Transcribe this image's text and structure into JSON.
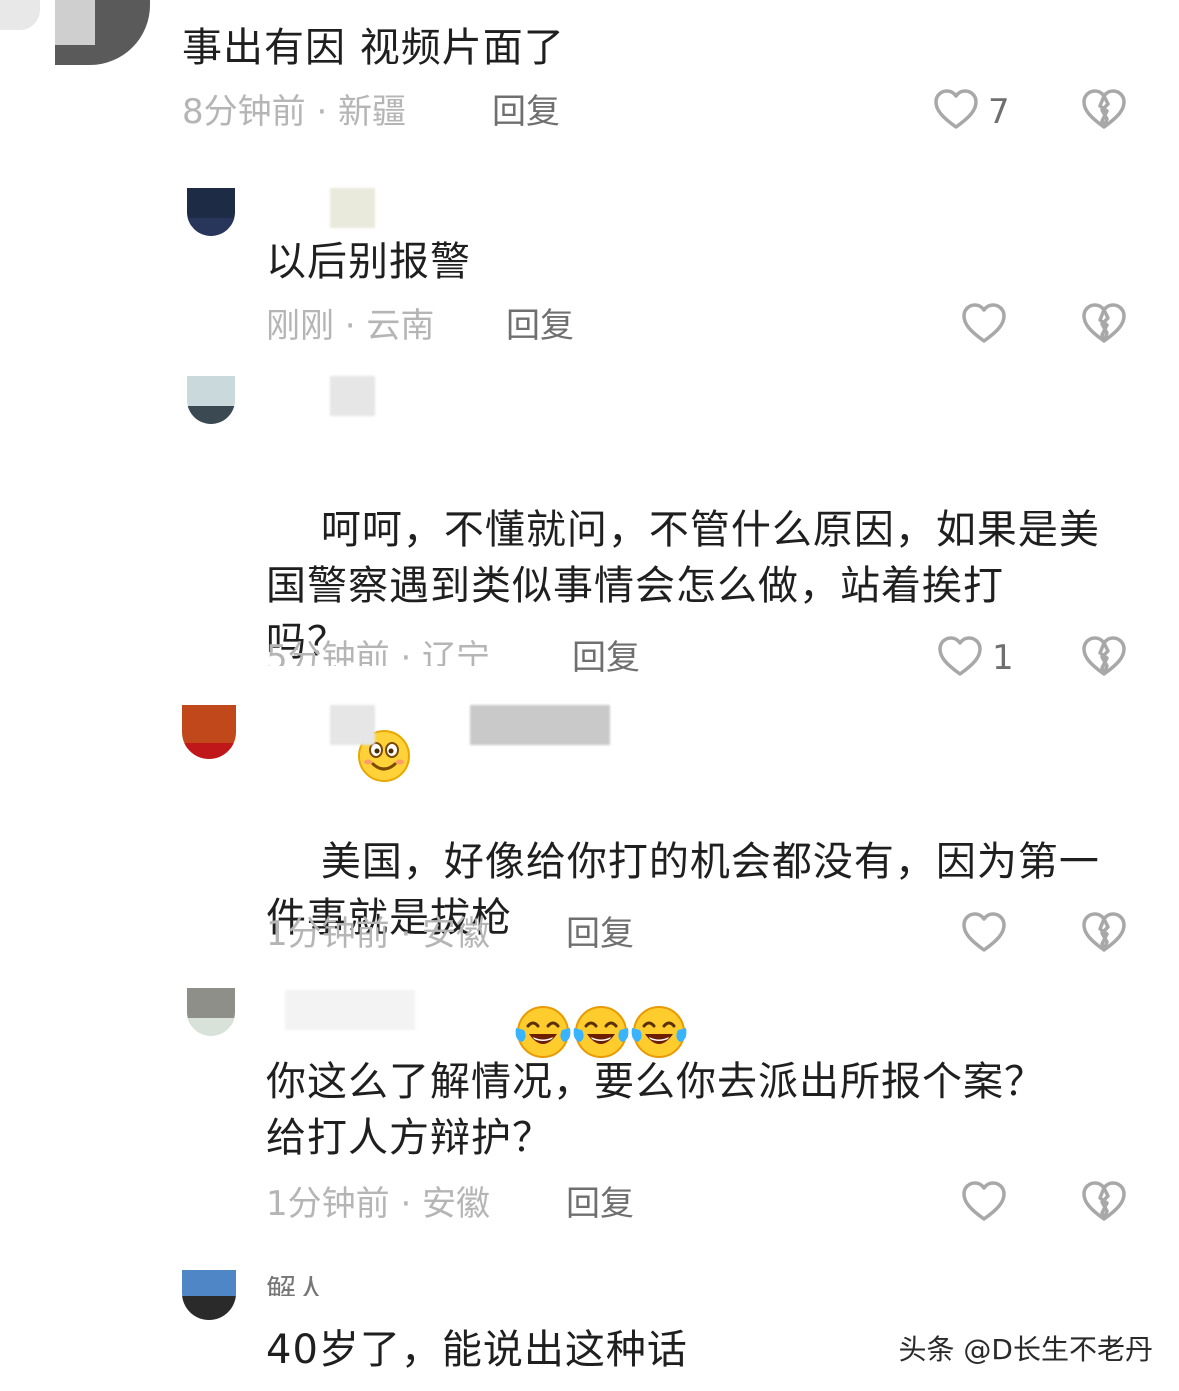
{
  "comments": [
    {
      "text": "事出有因 视频片面了",
      "time_loc": "8分钟前 · 新疆",
      "reply": "回复",
      "likes": "7"
    },
    {
      "text": "以后别报警",
      "time_loc": "刚刚 · 云南",
      "reply": "回复",
      "likes": ""
    },
    {
      "text": "呵呵，不懂就问，不管什么原因，如果是美\n国警察遇到类似事情会怎么做，站着挨打\n吗？",
      "time_loc": "5分钟前 · 辽宁",
      "reply": "回复",
      "likes": "1"
    },
    {
      "text": "美国，好像给你打的机会都没有，因为第一\n件事就是拔枪",
      "time_loc": "1分钟前 · 安徽",
      "reply": "回复",
      "likes": ""
    },
    {
      "text": "你这么了解情况，要么你去派出所报个案？\n给打人方辩护？",
      "time_loc": "1分钟前 · 安徽",
      "reply": "回复",
      "likes": ""
    },
    {
      "text": "40岁了，能说出这种话",
      "time_loc": "",
      "reply": "",
      "likes": ""
    }
  ],
  "partial_name": "解人",
  "watermark": "头条 @D长生不老丹",
  "icons": {
    "like": "heart-outline-icon",
    "dislike": "broken-heart-icon",
    "smile": "smile-emoji-icon",
    "laugh": "tears-of-joy-emoji-icon"
  },
  "colors": {
    "text": "#1f1f1f",
    "meta": "#b5b5b5",
    "reply": "#6f6f6f",
    "icon": "#a8a8a8"
  }
}
